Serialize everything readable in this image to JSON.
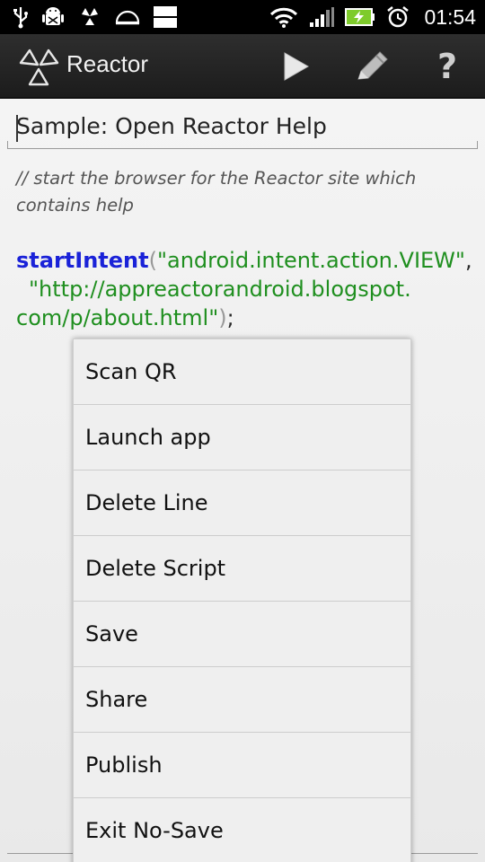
{
  "status_bar": {
    "time": "01:54",
    "icons": [
      "usb-icon",
      "android-debug-icon",
      "reactor-notification-icon",
      "dome-icon",
      "sd-card-icon",
      "wifi-icon",
      "signal-icon",
      "battery-charging-icon",
      "alarm-icon"
    ]
  },
  "action_bar": {
    "title": "Reactor",
    "actions": [
      "play-icon",
      "pencil-icon",
      "help-icon"
    ],
    "help_glyph": "?"
  },
  "editor": {
    "script_title": "Sample: Open Reactor Help",
    "comment_line1": "// start the browser for the Reactor site which",
    "comment_line2": "contains help",
    "code_fn": "startIntent",
    "code_open": "(",
    "code_arg1": "\"android.intent.action.VIEW\"",
    "code_comma": ",",
    "code_arg2a": "\"http://appreactorandroid.blogspot.",
    "code_arg2b": "com/p/about.html\"",
    "code_close": ")",
    "code_semicolon": ";"
  },
  "menu": {
    "items": [
      "Scan QR",
      "Launch app",
      "Delete Line",
      "Delete Script",
      "Save",
      "Share",
      "Publish",
      "Exit No-Save"
    ]
  },
  "colors": {
    "function": "#1a22d8",
    "string": "#1f8f1f",
    "comment": "#555555"
  }
}
